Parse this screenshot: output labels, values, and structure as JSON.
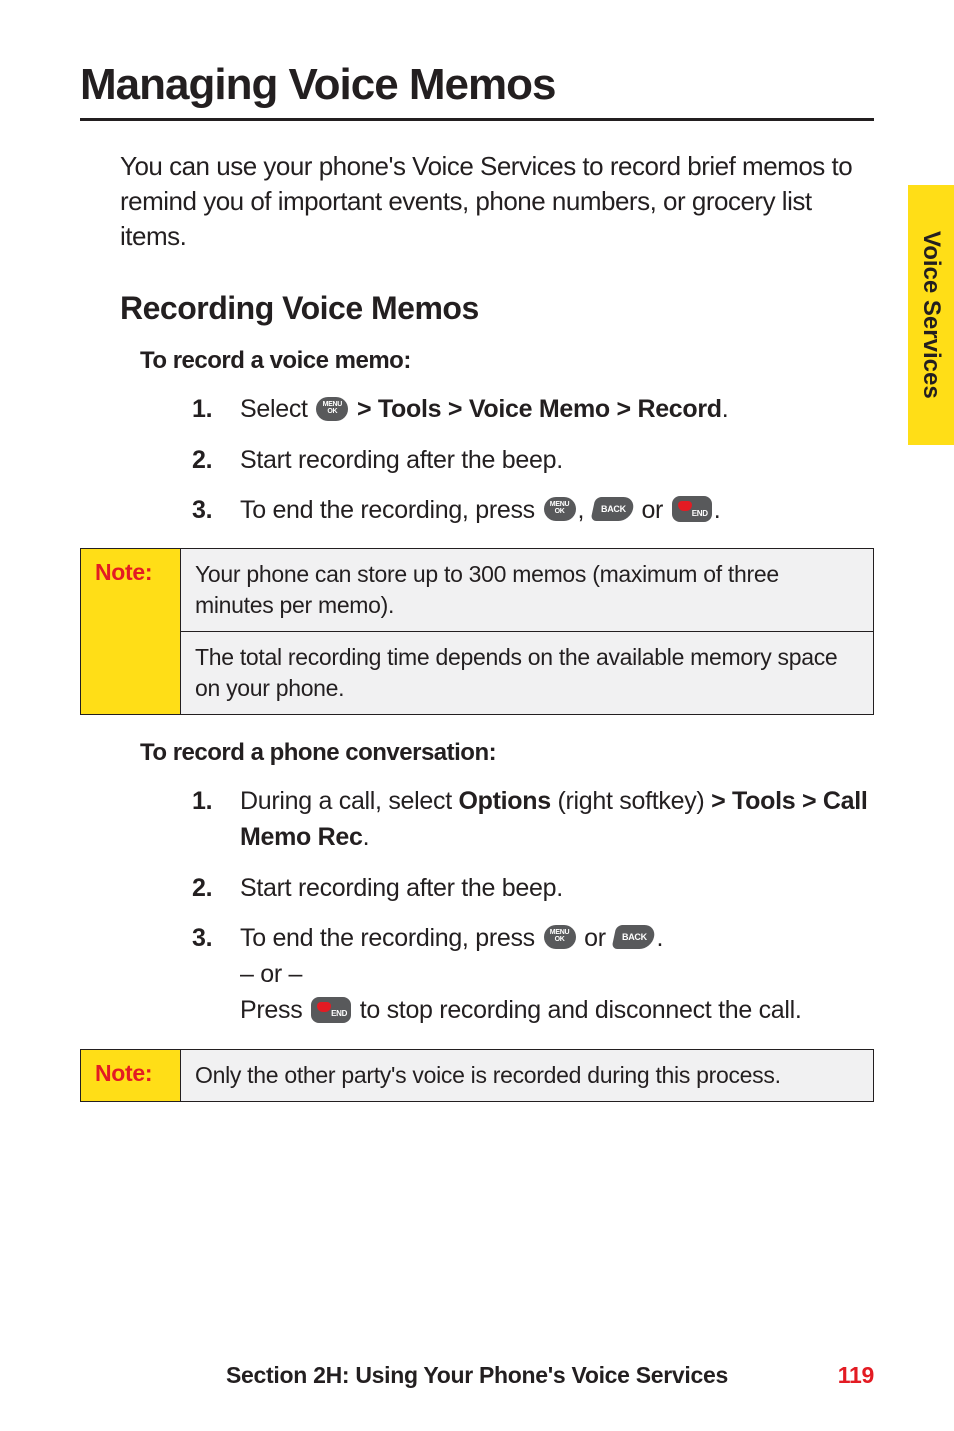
{
  "sideTab": "Voice Services",
  "heading": "Managing Voice Memos",
  "intro": "You can use your phone's Voice Services to record brief memos to remind you of important events, phone numbers, or grocery list items.",
  "subheading": "Recording Voice Memos",
  "section1": {
    "title": "To record a voice memo:",
    "steps": {
      "s1_prefix": "Select ",
      "s1_suffix": " > Tools > Voice Memo > Record",
      "s1_period": ".",
      "s2": "Start recording after the beep.",
      "s3_prefix": "To end the recording, press ",
      "s3_mid": ", ",
      "s3_or": " or ",
      "s3_period": "."
    }
  },
  "note1": {
    "label": "Note:",
    "row1": "Your phone can store up to 300 memos (maximum of three minutes per memo).",
    "row2": "The total recording time depends on the available memory space on your phone."
  },
  "section2": {
    "title": "To record a phone conversation:",
    "steps": {
      "s1_prefix": "During a call, select ",
      "s1_options": "Options",
      "s1_mid": " (right softkey) ",
      "s1_path": "> Tools > Call Memo Rec",
      "s1_period": ".",
      "s2": "Start recording after the beep.",
      "s3_prefix": "To end the recording, press ",
      "s3_or": " or ",
      "s3_period": ".",
      "s3_orline": "– or –",
      "s3_press_prefix": "Press ",
      "s3_press_suffix": " to stop recording and disconnect the call."
    }
  },
  "note2": {
    "label": "Note:",
    "body": "Only the other party's voice is recorded during this process."
  },
  "footer": {
    "text": "Section 2H: Using Your Phone's Voice Services",
    "page": "119"
  },
  "icons": {
    "back": "BACK"
  }
}
